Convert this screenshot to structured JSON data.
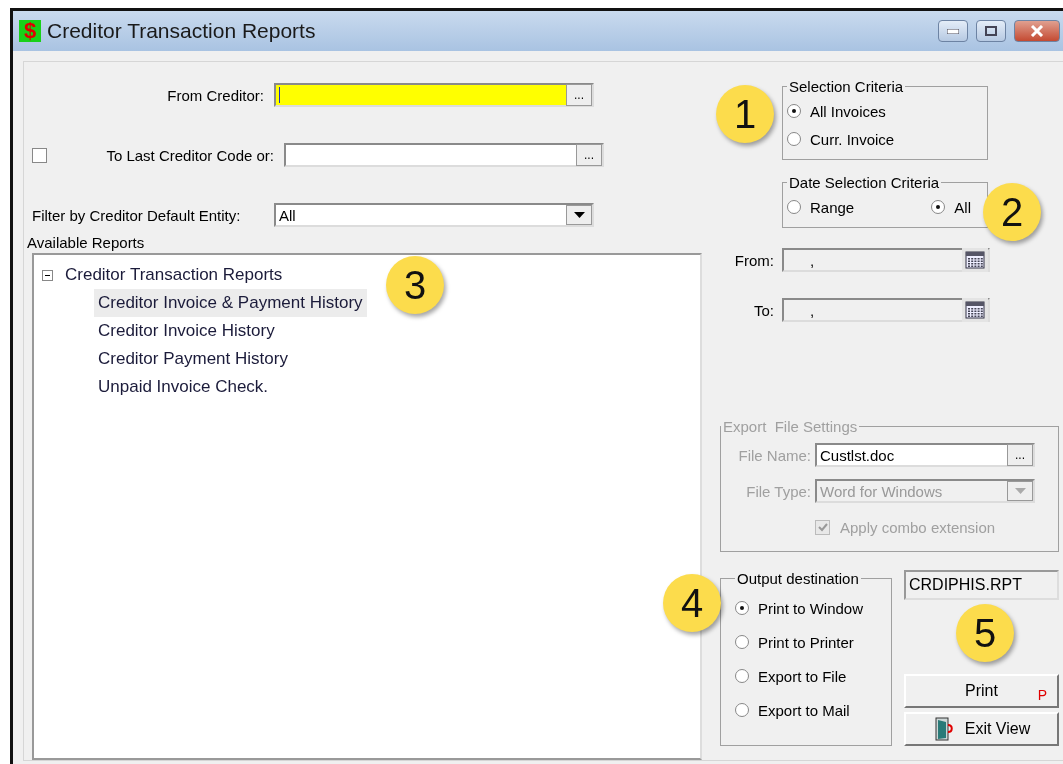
{
  "window": {
    "title": "Creditor Transaction Reports",
    "icon_glyph": "$"
  },
  "from_creditor": {
    "label": "From Creditor:",
    "focused": true,
    "browse": "..."
  },
  "to_last": {
    "label": "To Last Creditor Code or:",
    "checked": false,
    "browse": "..."
  },
  "filter": {
    "label": "Filter by Creditor Default Entity:",
    "value": "All"
  },
  "available_reports": {
    "label": "Available Reports",
    "tree": [
      {
        "label": "Creditor Transaction Reports",
        "expanded": true,
        "selected": false,
        "children": [
          {
            "label": "Creditor Invoice & Payment History",
            "selected": true
          },
          {
            "label": "Creditor Invoice History",
            "selected": false
          },
          {
            "label": "Creditor Payment History",
            "selected": false
          },
          {
            "label": "Unpaid Invoice Check.",
            "selected": false
          }
        ]
      }
    ]
  },
  "selection_criteria": {
    "title": "Selection Criteria",
    "options": [
      {
        "label": "All Invoices",
        "selected": true
      },
      {
        "label": "Curr. Invoice",
        "selected": false
      }
    ]
  },
  "date_selection": {
    "title": "Date Selection Criteria",
    "options": [
      {
        "label": "Range",
        "selected": false
      },
      {
        "label": "All",
        "selected": true
      }
    ]
  },
  "date_range": [
    {
      "label": "From:",
      "value": ","
    },
    {
      "label": "To:",
      "value": ","
    }
  ],
  "export_settings": {
    "title": "Export  File Settings",
    "disabled": true,
    "file_name": {
      "label": "File Name:",
      "value": "Custlst.doc",
      "browse": "..."
    },
    "file_type": {
      "label": "File Type:",
      "value": "Word for Windows"
    },
    "apply_combo": {
      "label": "Apply combo extension",
      "checked": true
    }
  },
  "output_destination": {
    "title": "Output destination",
    "options": [
      {
        "label": "Print to Window",
        "selected": true
      },
      {
        "label": "Print to Printer",
        "selected": false
      },
      {
        "label": "Export to File",
        "selected": false
      },
      {
        "label": "Export to Mail",
        "selected": false
      }
    ]
  },
  "report_file": "CRDIPHIS.RPT",
  "buttons": [
    {
      "kind": "print",
      "label": "Print",
      "shortcut": "P"
    },
    {
      "kind": "exit",
      "label": "Exit View"
    }
  ],
  "callouts": [
    "1",
    "2",
    "3",
    "4",
    "5"
  ]
}
